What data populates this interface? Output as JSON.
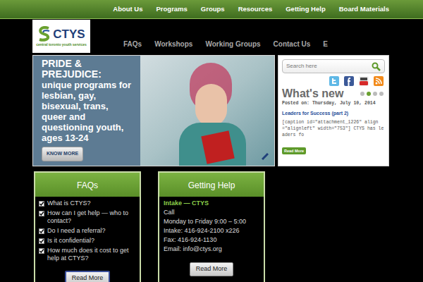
{
  "top_nav": [
    "About Us",
    "Programs",
    "Groups",
    "Resources",
    "Getting Help",
    "Board Materials"
  ],
  "logo": {
    "name": "CTYS",
    "tagline": "central toronto youth services"
  },
  "secondary_nav": [
    "FAQs",
    "Workshops",
    "Working Groups",
    "Contact Us",
    "E"
  ],
  "slider": {
    "heading": "PRIDE & PREJUDICE:",
    "body": "unique programs for lesbian, gay, bisexual, trans, queer and questioning youth, ages 13-24",
    "button": "KNOW MORE"
  },
  "sidebar": {
    "search": {
      "placeholder": "Search here"
    },
    "whats_new": {
      "title": "What's new",
      "dots": [
        {
          "selected": false
        },
        {
          "selected": true
        },
        {
          "selected": false
        },
        {
          "selected": false
        }
      ],
      "posted": "Posted on: Thursday, July 10, 2014",
      "post_title": "Leaders for Success (part 2)",
      "excerpt": "[caption id=\"attachment_1226\" align=\"alignleft\" width=\"753\"] CTYS has leaders fo",
      "button": "Read More"
    }
  },
  "faqs": {
    "title": "FAQs",
    "items": [
      "What is CTYS?",
      "How can I get help — who to contact?",
      "Do I need a referral?",
      "Is it confidential?",
      "How much does it cost to get help at CTYS?"
    ],
    "button": "Read More"
  },
  "getting_help": {
    "title": "Getting Help",
    "lines": [
      {
        "text": "Intake — CTYS",
        "kind": "link"
      },
      {
        "text": "Call",
        "kind": "text"
      },
      {
        "text": "Monday to Friday 9:00 – 5:00",
        "kind": "text"
      },
      {
        "text": "Intake: 416-924-2100 x226",
        "kind": "text"
      },
      {
        "text": "Fax: 416-924-1130",
        "kind": "text"
      },
      {
        "text": "Email: info@ctys.org",
        "kind": "text"
      }
    ],
    "button": "Read More"
  }
}
